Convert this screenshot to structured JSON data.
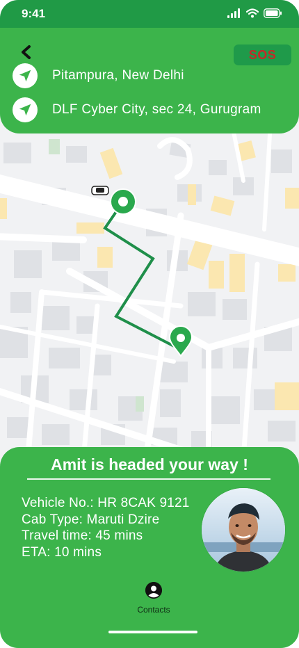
{
  "status_bar": {
    "time": "9:41"
  },
  "header": {
    "back_icon": "chevron-left-icon",
    "sos_label": "SOS",
    "pickup": "Pitampura, New Delhi",
    "drop": "DLF Cyber City, sec 24, Gurugram",
    "location_icon": "navigation-arrow-icon"
  },
  "sheet": {
    "headline": "Amit is headed your way !",
    "vehicle": "Vehicle No.: HR 8CAK 9121",
    "cab_type": "Cab Type: Maruti Dzire",
    "travel_time": "Travel time: 45 mins",
    "eta": "ETA: 10 mins",
    "contacts_label": "Contacts"
  },
  "colors": {
    "primary_green": "#3cb44b",
    "dark_green": "#209a46",
    "route_green": "#1f8f4a",
    "sos_red": "#c62828"
  }
}
